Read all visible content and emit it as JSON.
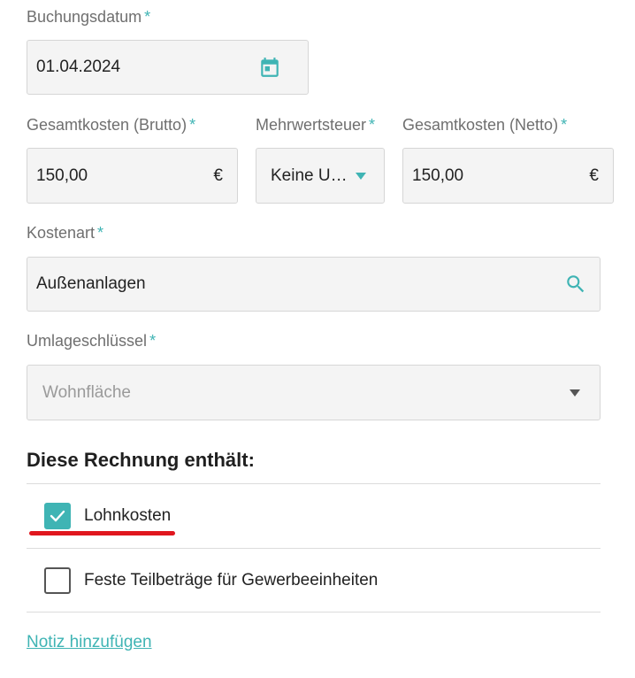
{
  "booking_date": {
    "label": "Buchungsdatum",
    "required_mark": "*",
    "value": "01.04.2024",
    "icon": "calendar-icon"
  },
  "gross_cost": {
    "label": "Gesamtkosten (Brutto)",
    "required_mark": "*",
    "value": "150,00",
    "currency": "€"
  },
  "vat": {
    "label": "Mehrwertsteuer",
    "required_mark": "*",
    "value": "Keine U…"
  },
  "net_cost": {
    "label": "Gesamtkosten (Netto)",
    "required_mark": "*",
    "value": "150,00",
    "currency": "€"
  },
  "cost_type": {
    "label": "Kostenart",
    "required_mark": "*",
    "value": "Außenanlagen",
    "icon": "search-icon"
  },
  "allocation_key": {
    "label": "Umlageschlüssel",
    "required_mark": "*",
    "value": "Wohnfläche"
  },
  "invoice_section": {
    "heading": "Diese Rechnung enthält:",
    "options": [
      {
        "label": "Lohnkosten",
        "checked": true
      },
      {
        "label": "Feste Teilbeträge für Gewerbeeinheiten",
        "checked": false
      }
    ]
  },
  "add_note_link": "Notiz hinzufügen",
  "colors": {
    "accent": "#3fb4b4",
    "annotation_red": "#e0161e",
    "field_bg": "#f4f4f4"
  }
}
